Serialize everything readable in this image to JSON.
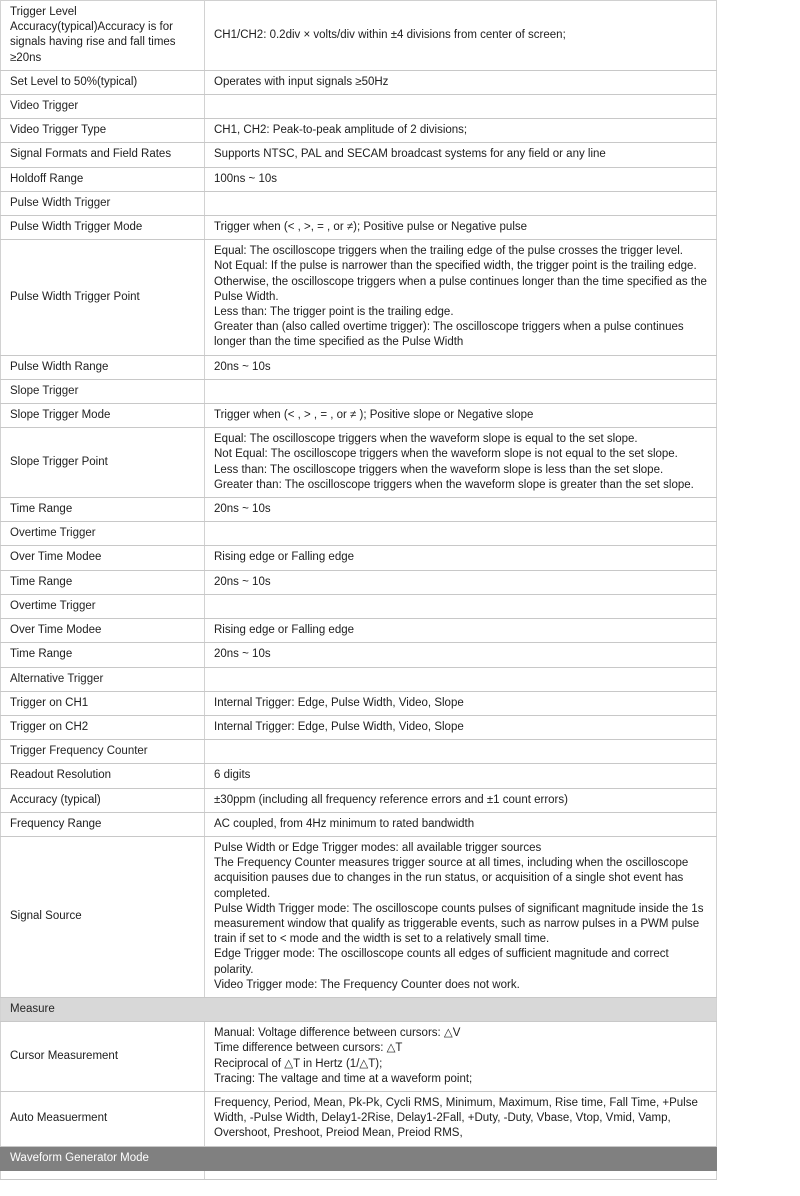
{
  "document": {
    "kind": "oscilloscope-specification-table",
    "column_count": 2
  },
  "colors": {
    "section_header_bg": "#d6d6d6",
    "section_full_bg": "#d8d8d8",
    "section_dark_bg": "#808080",
    "border": "#d2d2d2",
    "text": "#202020",
    "page_bg": "#ffffff"
  },
  "rows": [
    {
      "type": "pair",
      "label": "Trigger Level Accuracy(typical)Accuracy is for signals having rise and fall times ≥20ns",
      "value": "CH1/CH2: 0.2div × volts/div within ±4 divisions from center of screen;"
    },
    {
      "type": "pair",
      "label": "Set Level to 50%(typical)",
      "value": "Operates with input signals ≥50Hz"
    },
    {
      "type": "section",
      "label": "Video Trigger",
      "value": ""
    },
    {
      "type": "pair",
      "label": "Video Trigger Type",
      "value": "CH1, CH2: Peak-to-peak amplitude of 2 divisions;"
    },
    {
      "type": "pair",
      "label": "Signal Formats and Field Rates",
      "value": "Supports NTSC, PAL and SECAM broadcast systems for any field or any line"
    },
    {
      "type": "pair",
      "label": "Holdoff Range",
      "value": "100ns ~ 10s"
    },
    {
      "type": "section",
      "label": "Pulse Width Trigger",
      "value": ""
    },
    {
      "type": "pair",
      "label": "Pulse Width Trigger Mode",
      "value": "Trigger when (< , >, = , or ≠); Positive pulse or Negative pulse"
    },
    {
      "type": "pair",
      "label": "Pulse Width Trigger Point",
      "value": "Equal: The oscilloscope triggers when the trailing edge of the pulse crosses the trigger level.\nNot Equal: If the pulse is narrower than the specified width, the trigger point is the trailing edge. Otherwise, the oscilloscope triggers when a pulse continues longer than the time specified as the Pulse Width.\nLess than: The trigger point is the trailing edge.\nGreater than (also called overtime trigger): The oscilloscope triggers when a pulse continues longer than the time specified as the Pulse Width"
    },
    {
      "type": "pair",
      "label": "Pulse Width Range",
      "value": "20ns ~ 10s"
    },
    {
      "type": "section",
      "label": "Slope Trigger",
      "value": ""
    },
    {
      "type": "pair",
      "label": "Slope Trigger Mode",
      "value": "Trigger when (< , > , = , or ≠ ); Positive slope or Negative slope"
    },
    {
      "type": "pair",
      "label": "Slope Trigger Point",
      "value": "Equal: The oscilloscope triggers when the waveform slope is equal to the set slope.\nNot Equal: The oscilloscope triggers when the waveform slope is not equal to the set slope.\nLess than: The oscilloscope triggers when the waveform slope is less than the set slope.\nGreater than: The oscilloscope triggers when the waveform slope is greater than the set slope."
    },
    {
      "type": "pair",
      "label": "Time Range",
      "value": "20ns ~ 10s"
    },
    {
      "type": "section",
      "label": "Overtime Trigger",
      "value": ""
    },
    {
      "type": "pair",
      "label": "Over Time Modee",
      "value": "Rising edge or Falling edge"
    },
    {
      "type": "pair",
      "label": "Time Range",
      "value": "20ns ~ 10s"
    },
    {
      "type": "section",
      "label": "Overtime Trigger",
      "value": ""
    },
    {
      "type": "pair",
      "label": "Over Time Modee",
      "value": "Rising edge or Falling edge"
    },
    {
      "type": "pair",
      "label": "Time Range",
      "value": "20ns ~ 10s"
    },
    {
      "type": "section",
      "label": "Alternative Trigger",
      "value": ""
    },
    {
      "type": "pair",
      "label": "Trigger on CH1",
      "value": "Internal Trigger: Edge, Pulse Width, Video, Slope"
    },
    {
      "type": "pair",
      "label": "Trigger on CH2",
      "value": "Internal Trigger: Edge, Pulse Width, Video, Slope"
    },
    {
      "type": "section",
      "label": "Trigger Frequency Counter",
      "value": ""
    },
    {
      "type": "pair",
      "label": "Readout Resolution",
      "value": "6 digits"
    },
    {
      "type": "pair",
      "label": "Accuracy (typical)",
      "value": "±30ppm (including all frequency reference errors and ±1 count errors)"
    },
    {
      "type": "pair",
      "label": "Frequency Range",
      "value": "AC coupled, from 4Hz minimum to rated bandwidth"
    },
    {
      "type": "pair",
      "label": "Signal Source",
      "value": "Pulse Width or Edge Trigger modes: all available trigger sources\nThe Frequency Counter measures trigger source at all times, including when the oscilloscope acquisition pauses due to changes in the run status, or acquisition of a single shot event has completed.\nPulse Width Trigger mode: The oscilloscope counts pulses of significant magnitude inside the 1s measurement window that qualify as triggerable events, such as narrow pulses in a PWM pulse train if set to < mode and the width is set to a relatively small time.\nEdge Trigger mode: The oscilloscope counts all edges of sufficient magnitude and correct polarity.\nVideo Trigger mode: The Frequency Counter does not work."
    },
    {
      "type": "section-full",
      "label": "Measure",
      "value": ""
    },
    {
      "type": "pair",
      "label": "Cursor Measurement",
      "value": "Manual: Voltage difference between cursors: △V\n          Time difference between cursors: △T\n          Reciprocal of △T in Hertz (1/△T);\nTracing: The valtage and time at a waveform point;"
    },
    {
      "type": "pair",
      "label": "Auto Measuerment",
      "value": "Frequency, Period, Mean, Pk-Pk, Cycli RMS, Minimum, Maximum, Rise time, Fall Time, +Pulse Width, -Pulse Width, Delay1-2Rise, Delay1-2Fall, +Duty, -Duty, Vbase, Vtop, Vmid, Vamp, Overshoot, Preshoot, Preiod Mean, Preiod RMS,"
    },
    {
      "type": "section-dark",
      "label": "Waveform Generator Mode",
      "value": ""
    },
    {
      "type": "pair",
      "label": "",
      "value": ""
    }
  ]
}
